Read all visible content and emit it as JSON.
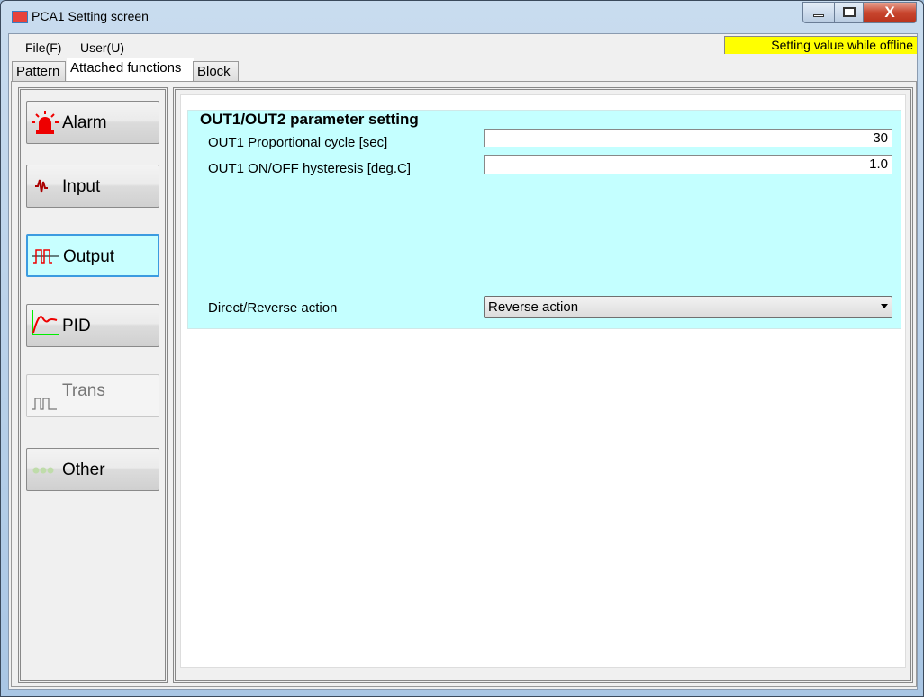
{
  "window": {
    "title": "PCA1 Setting screen",
    "icon_text": "PCA1",
    "close_label": "X"
  },
  "menu": [
    {
      "label": "File(F)"
    },
    {
      "label": "User(U)"
    }
  ],
  "status": {
    "text": "Setting value while offline",
    "color": "#ffff00"
  },
  "tabs": [
    {
      "label": "Pattern"
    },
    {
      "label": "Attached functions",
      "selected": true
    },
    {
      "label": "Block"
    }
  ],
  "sidebar": {
    "items": [
      {
        "label": "Alarm",
        "icon": "alarm-light-icon"
      },
      {
        "label": "Input",
        "icon": "signal-wave-icon"
      },
      {
        "label": "Output",
        "icon": "square-wave-icon",
        "active": true
      },
      {
        "label": "PID",
        "icon": "pid-response-icon"
      },
      {
        "label": "Trans",
        "icon": "pulse-icon",
        "disabled": true
      },
      {
        "label": "Other",
        "icon": "dots-icon"
      }
    ]
  },
  "group": {
    "title": "OUT1/OUT2 parameter setting",
    "fields": [
      {
        "label": "OUT1 Proportional cycle [sec]",
        "value": "30"
      },
      {
        "label": "OUT1 ON/OFF hysteresis [deg.C]",
        "value": "1.0"
      }
    ],
    "action": {
      "label": "Direct/Reverse action",
      "value": "Reverse action"
    },
    "background": "#c4ffff"
  }
}
